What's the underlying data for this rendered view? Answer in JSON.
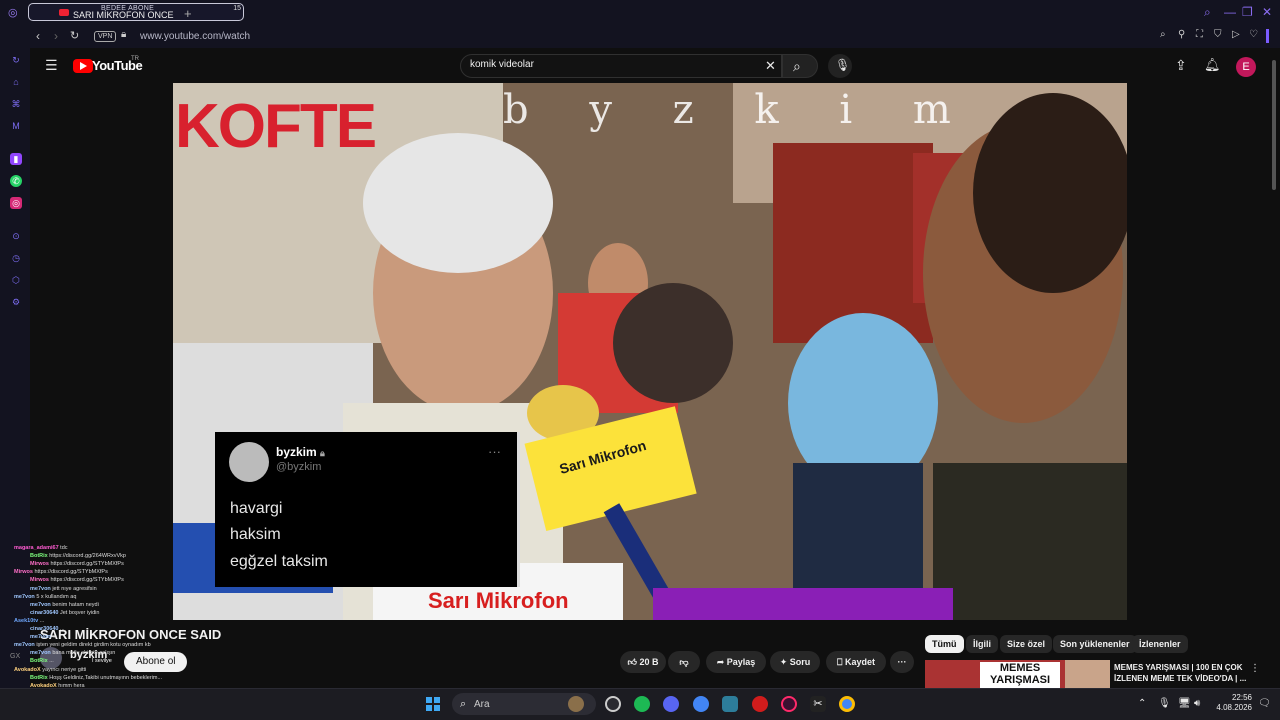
{
  "browser": {
    "tab_title_top": "BEDEE ABONE",
    "tab_title": "SARI MİKROFON ONCE",
    "tab_count": "15",
    "vpn": "VPN",
    "url": "www.youtube.com/watch"
  },
  "youtube": {
    "logo_text": "YouTube",
    "logo_region": "TR",
    "search_value": "komik videolar",
    "avatar_letter": "E"
  },
  "video": {
    "watermark": "b y z k i m",
    "sign_text": "KOFTE",
    "mic_brand": "Sarı Mikrofon",
    "banner_text": "Sarı Mikrofon",
    "tweet": {
      "name": "byzkim",
      "handle": "@byzkim",
      "lines": [
        "havargi",
        "haksim",
        "egğzel taksim"
      ]
    }
  },
  "below": {
    "title": "SARI MİKROFON ONCE SAID",
    "channel": "byzkim",
    "subscribe": "Abone ol",
    "like_count": "20 B",
    "share": "Paylaş",
    "ask": "Soru",
    "save": "Kaydet",
    "chips": [
      "Tümü",
      "İlgili",
      "Size özel",
      "Son yüklenenler",
      "İzlenenler"
    ],
    "rec_title": "MEMES YARIŞMASI | 100 EN ÇOK İZLENEN MEME TEK VİDEO'DA | ...",
    "rec_thumb_text": "MEMES YARIŞMASI"
  },
  "chat": [
    {
      "user": "magara_adami67",
      "msg": "tdc",
      "color": "#ff5cd2"
    },
    {
      "user": "BotRix",
      "msg": "https://discord.gg/264WRxvVkp",
      "color": "#7fff7f"
    },
    {
      "user": "Mirwos",
      "msg": "https://discord.gg/STYbMXfPs",
      "color": "#ff6fc8"
    },
    {
      "user": "Mirwos",
      "msg": "https://discord.gg/STYbMXfPs",
      "color": "#ff6fc8"
    },
    {
      "user": "Mirwos",
      "msg": "https://discord.gg/STYbMXfPs",
      "color": "#ff6fc8"
    },
    {
      "user": "me7von",
      "msg": "jett nıye agresifsin",
      "color": "#a0c8ff"
    },
    {
      "user": "me7von",
      "msg": "5 x kullandım aq",
      "color": "#a0c8ff"
    },
    {
      "user": "me7von",
      "msg": "benim hatam neydi",
      "color": "#a0c8ff"
    },
    {
      "user": "cinar30640",
      "msg": "Jet boşver iyidin",
      "color": "#a0c8ff"
    },
    {
      "user": "Asek10tv",
      "msg": "...",
      "color": "#6fa8ff"
    },
    {
      "user": "cinar30640",
      "msg": "...",
      "color": "#a0c8ff"
    },
    {
      "user": "me7von",
      "msg": "...",
      "color": "#a0c8ff"
    },
    {
      "user": "me7von",
      "msg": "işten yeni geldim direkt girdim kotu oynadım kb",
      "color": "#a0c8ff"
    },
    {
      "user": "me7von",
      "msg": "bana mutlu ahirete çalışın",
      "color": "#a0c8ff"
    },
    {
      "user": "BotRix",
      "msg": "...",
      "color": "#7fff7f"
    },
    {
      "user": "AvokadoX",
      "msg": "yayıncı neriye gitti",
      "color": "#ffd27f"
    },
    {
      "user": "BotRix",
      "msg": "Hoşş Geldiniz,Takibi unutmayınn bebeklerim...",
      "color": "#7fff7f"
    },
    {
      "user": "AvokadoX",
      "msg": "hımm hera",
      "color": "#ffd27f"
    },
    {
      "user": "BotRix",
      "msg": "Aramıza hoş geldin @Falcrza45",
      "color": "#7fff7f"
    },
    {
      "user": "me7von",
      "msg": "neyse iyi yayınlar",
      "color": "#a0c8ff"
    },
    {
      "user": "Asek10tv",
      "msg": "Çok büyüttü",
      "color": "#6fa8ff"
    }
  ],
  "chat_extra": {
    "line_a": "I sevilye",
    "badge": "GX"
  },
  "taskbar": {
    "search": "Ara",
    "time": "22:56",
    "date": "4.08.2026"
  }
}
